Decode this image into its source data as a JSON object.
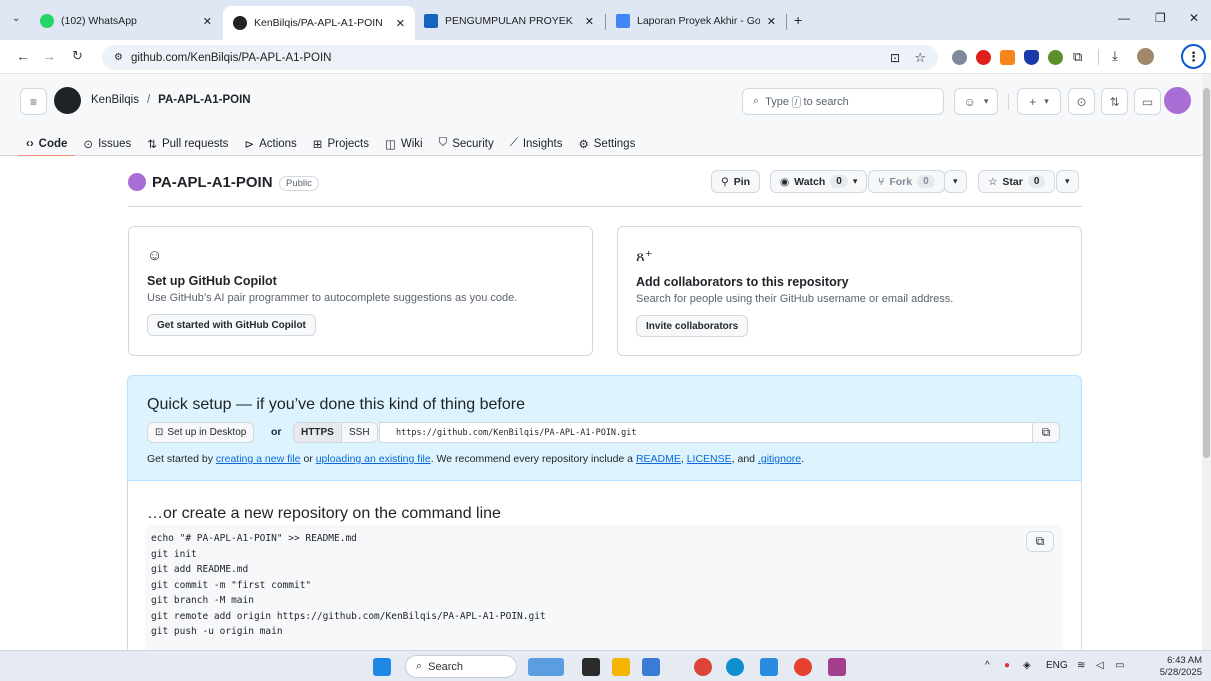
{
  "browser": {
    "tabs": [
      {
        "title": "(102) WhatsApp",
        "badge_color": "#25d366"
      },
      {
        "title": "KenBilqis/PA-APL-A1-POIN",
        "active": true
      },
      {
        "title": "PENGUMPULAN PROYEK AKHIR"
      },
      {
        "title": "Laporan Proyek Akhir - Google"
      }
    ],
    "new_tab": "+",
    "url": "github.com/KenBilqis/PA-APL-A1-POIN"
  },
  "gh": {
    "owner": "KenBilqis",
    "separator": "/",
    "repo": "PA-APL-A1-POIN",
    "search_placeholder_pre": "Type",
    "search_key": "/",
    "search_placeholder_post": "to search",
    "nav": [
      {
        "label": "Code",
        "icon": "code-icon"
      },
      {
        "label": "Issues",
        "icon": "issue-icon"
      },
      {
        "label": "Pull requests",
        "icon": "pull-request-icon"
      },
      {
        "label": "Actions",
        "icon": "play-icon"
      },
      {
        "label": "Projects",
        "icon": "table-icon"
      },
      {
        "label": "Wiki",
        "icon": "book-icon"
      },
      {
        "label": "Security",
        "icon": "shield-icon"
      },
      {
        "label": "Insights",
        "icon": "graph-icon"
      },
      {
        "label": "Settings",
        "icon": "gear-icon"
      }
    ]
  },
  "repo": {
    "title": "PA-APL-A1-POIN",
    "visibility": "Public",
    "pin": "Pin",
    "watch": "Watch",
    "watch_count": "0",
    "fork": "Fork",
    "fork_count": "0",
    "star": "Star",
    "star_count": "0"
  },
  "cards": {
    "copilot": {
      "title": "Set up GitHub Copilot",
      "desc": "Use GitHub’s AI pair programmer to autocomplete suggestions as you code.",
      "button": "Get started with GitHub Copilot"
    },
    "collab": {
      "title": "Add collaborators to this repository",
      "desc": "Search for people using their GitHub username or email address.",
      "button": "Invite collaborators"
    }
  },
  "quick": {
    "title": "Quick setup — if you’ve done this kind of thing before",
    "desktop": "Set up in Desktop",
    "or": "or",
    "https": "HTTPS",
    "ssh": "SSH",
    "clone_url": "https://github.com/KenBilqis/PA-APL-A1-POIN.git",
    "hint_1": "Get started by",
    "link_new": "creating a new file",
    "hint_2": "or",
    "link_upload": "uploading an existing file",
    "hint_3": ". We recommend every repository include a",
    "link_readme": "README",
    "hint_4": ",",
    "link_license": "LICENSE",
    "hint_5": ", and",
    "link_gitignore": ".gitignore",
    "hint_6": "."
  },
  "cmd": {
    "title": "…or create a new repository on the command line",
    "code": "echo \"# PA-APL-A1-POIN\" >> README.md\ngit init\ngit add README.md\ngit commit -m \"first commit\"\ngit branch -M main\ngit remote add origin https://github.com/KenBilqis/PA-APL-A1-POIN.git\ngit push -u origin main"
  },
  "taskbar": {
    "search": "Search",
    "lang": "ENG",
    "time": "6:43 AM",
    "date": "5/28/2025"
  }
}
